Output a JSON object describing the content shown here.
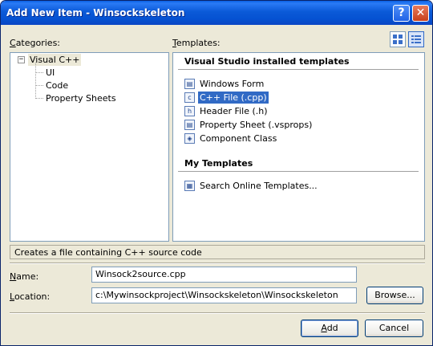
{
  "window": {
    "title": "Add New Item - Winsockskeleton",
    "help_glyph": "?",
    "close_glyph": "✕"
  },
  "categories": {
    "label_u": "C",
    "label_rest": "ategories:",
    "root": {
      "expander": "−",
      "label": "Visual C++"
    },
    "children": [
      "UI",
      "Code",
      "Property Sheets"
    ]
  },
  "templates": {
    "label_u": "T",
    "label_rest": "emplates:",
    "installed_header": "Visual Studio installed templates",
    "installed": [
      {
        "label": "Windows Form",
        "icon": "form-icon",
        "glyph": "▤"
      },
      {
        "label": "C++ File (.cpp)",
        "icon": "cpp-file-icon",
        "glyph": "c",
        "selected": true
      },
      {
        "label": "Header File (.h)",
        "icon": "header-file-icon",
        "glyph": "h"
      },
      {
        "label": "Property Sheet (.vsprops)",
        "icon": "property-sheet-icon",
        "glyph": "▤"
      },
      {
        "label": "Component Class",
        "icon": "component-class-icon",
        "glyph": "◈"
      }
    ],
    "my_header": "My Templates",
    "my": [
      {
        "label": "Search Online Templates...",
        "icon": "search-online-icon",
        "glyph": "▦"
      }
    ]
  },
  "view_buttons": {
    "large_icons": "large-icons-view-icon",
    "small_icons": "small-icons-view-icon"
  },
  "description": "Creates a file containing C++ source code",
  "name_field": {
    "label_u": "N",
    "label_rest": "ame:",
    "value": "Winsock2source.cpp"
  },
  "location_field": {
    "label_u": "L",
    "label_rest": "ocation:",
    "value": "c:\\Mywinsockproject\\Winsockskeleton\\Winsockskeleton"
  },
  "buttons": {
    "browse": "Browse...",
    "add_u": "A",
    "add_rest": "dd",
    "cancel": "Cancel"
  }
}
